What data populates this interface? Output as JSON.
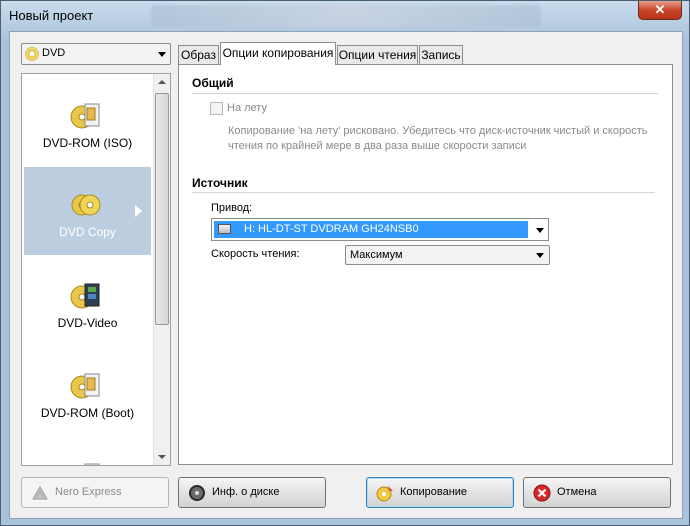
{
  "window": {
    "title": "Новый проект",
    "close_glyph": "✕"
  },
  "media_combo": {
    "value": "DVD"
  },
  "project_list": {
    "items": [
      {
        "label": "DVD-ROM (ISO)",
        "icon": "dvd-rom-icon",
        "selected": false
      },
      {
        "label": "DVD Copy",
        "icon": "dvd-copy-icon",
        "selected": true
      },
      {
        "label": "DVD-Video",
        "icon": "dvd-video-icon",
        "selected": false
      },
      {
        "label": "DVD-ROM (Boot)",
        "icon": "dvd-boot-icon",
        "selected": false
      }
    ]
  },
  "tabs": [
    {
      "label": "Образ",
      "active": false
    },
    {
      "label": "Опции копирования",
      "active": true
    },
    {
      "label": "Опции чтения",
      "active": false
    },
    {
      "label": "Запись",
      "active": false
    }
  ],
  "general": {
    "title": "Общий",
    "on_the_fly_label": "На лету",
    "on_the_fly_checked": false,
    "note": "Копирование 'на лету' рисковано. Убедитесь что диск-источник чистый и скорость чтения по крайней мере в два раза выше скорости записи"
  },
  "source": {
    "title": "Источник",
    "drive_label": "Привод:",
    "drive_value": "H: HL-DT-ST DVDRAM GH24NSB0",
    "speed_label": "Скорость чтения:",
    "speed_value": "Максимум"
  },
  "buttons": {
    "nero_express": "Nero Express",
    "disc_info": "Инф. о диске",
    "copy": "Копирование",
    "cancel": "Отмена"
  },
  "colors": {
    "selection": "#3399ff",
    "list_selected": "#bccee0",
    "cancel_icon": "#d8262b"
  }
}
